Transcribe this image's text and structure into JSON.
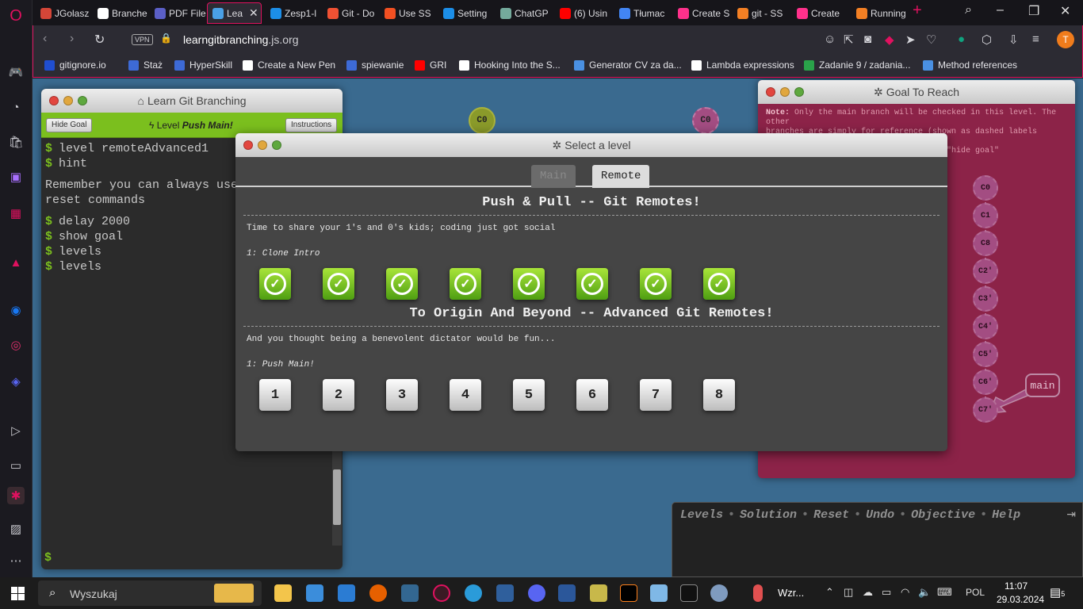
{
  "tabs": [
    {
      "label": "JGolasz",
      "color": "#d44638"
    },
    {
      "label": "Branche",
      "color": "#ffffff"
    },
    {
      "label": "PDF File",
      "color": "#5b5fc7"
    },
    {
      "label": "Lea",
      "color": "#4aa0e6",
      "active": true
    },
    {
      "label": "Zesp1-l",
      "color": "#1c8ee8"
    },
    {
      "label": "Git - Do",
      "color": "#f05133"
    },
    {
      "label": "Use SS",
      "color": "#f25022"
    },
    {
      "label": "Setting",
      "color": "#1c8ee8"
    },
    {
      "label": "ChatGP",
      "color": "#74aa9c"
    },
    {
      "label": "(6) Usin",
      "color": "#ff0000"
    },
    {
      "label": "Tłumac",
      "color": "#4285f4"
    },
    {
      "label": "Create S",
      "color": "#ff318c"
    },
    {
      "label": "git - SS",
      "color": "#f48024"
    },
    {
      "label": "Create",
      "color": "#ff318c"
    },
    {
      "label": "Running",
      "color": "#f48024"
    }
  ],
  "address": {
    "vpn": "VPN",
    "url_prefix": "learngitbranching",
    "url_suffix": ".js.org",
    "avatar": "T"
  },
  "bookmarks": [
    {
      "label": "gitignore.io",
      "color": "#204ecf"
    },
    {
      "label": "Staż",
      "color": "#3d6ad6"
    },
    {
      "label": "HyperSkill",
      "color": "#3d6ad6"
    },
    {
      "label": "Create a New Pen",
      "color": "#ffffff"
    },
    {
      "label": "spiewanie",
      "color": "#3d6ad6"
    },
    {
      "label": "GRI",
      "color": "#ff0000"
    },
    {
      "label": "Hooking Into the S...",
      "color": "#ffffff"
    },
    {
      "label": "Generator CV za da...",
      "color": "#4a90e2"
    },
    {
      "label": "Lambda expressions",
      "color": "#ffffff"
    },
    {
      "label": "Zadanie 9 / zadania...",
      "color": "#2aa34a"
    },
    {
      "label": "Method references",
      "color": "#4a90e2"
    }
  ],
  "terminal": {
    "title": "Learn Git Branching",
    "hide_goal": "Hide Goal",
    "level_prefix": "Level",
    "level_name": "Push Main!",
    "instructions": "Instructions",
    "cmd1": "level remoteAdvanced1",
    "cmd2": "hint",
    "hint_line1": "Remember you can always use",
    "hint_line2": "reset commands",
    "cmd3": "delay 2000",
    "cmd4": "show goal",
    "cmd5": "levels",
    "cmd6": "levels",
    "prompt": "$"
  },
  "canvas": {
    "commit_a": "C0",
    "commit_b": "C0"
  },
  "goal": {
    "title": "Goal To Reach",
    "note_label": "Note:",
    "note_line1": "Only the main branch will be checked in this level. The other",
    "note_line2": "branches are simply for reference (shown as dashed labels below). As",
    "note_line3": "always, you can hide this dialog with \"hide goal\"",
    "commits": [
      "C0",
      "C1",
      "C8",
      "C2'",
      "C3'",
      "C4'",
      "C5'",
      "C6'",
      "C7'"
    ],
    "branch_main": "main"
  },
  "command_bar": {
    "links": [
      "Levels",
      "Solution",
      "Reset",
      "Undo",
      "Objective",
      "Help"
    ],
    "separator": "•"
  },
  "modal": {
    "title": "Select a level",
    "tab_main": "Main",
    "tab_remote": "Remote",
    "seq1_title": "Push & Pull -- Git Remotes!",
    "seq1_about": "Time to share your 1's and 0's kids; coding just got social",
    "seq1_sub": "1: Clone Intro",
    "seq2_title": "To Origin And Beyond -- Advanced Git Remotes!",
    "seq2_about": "And you thought being a benevolent dictator would be fun...",
    "seq2_sub": "1: Push Main!",
    "seq2_levels": [
      "1",
      "2",
      "3",
      "4",
      "5",
      "6",
      "7",
      "8"
    ]
  },
  "taskbar": {
    "search_placeholder": "Wyszukaj",
    "weather": "Wzr...",
    "lang": "POL",
    "time": "11:07",
    "date": "29.03.2024",
    "notifications": "5"
  }
}
